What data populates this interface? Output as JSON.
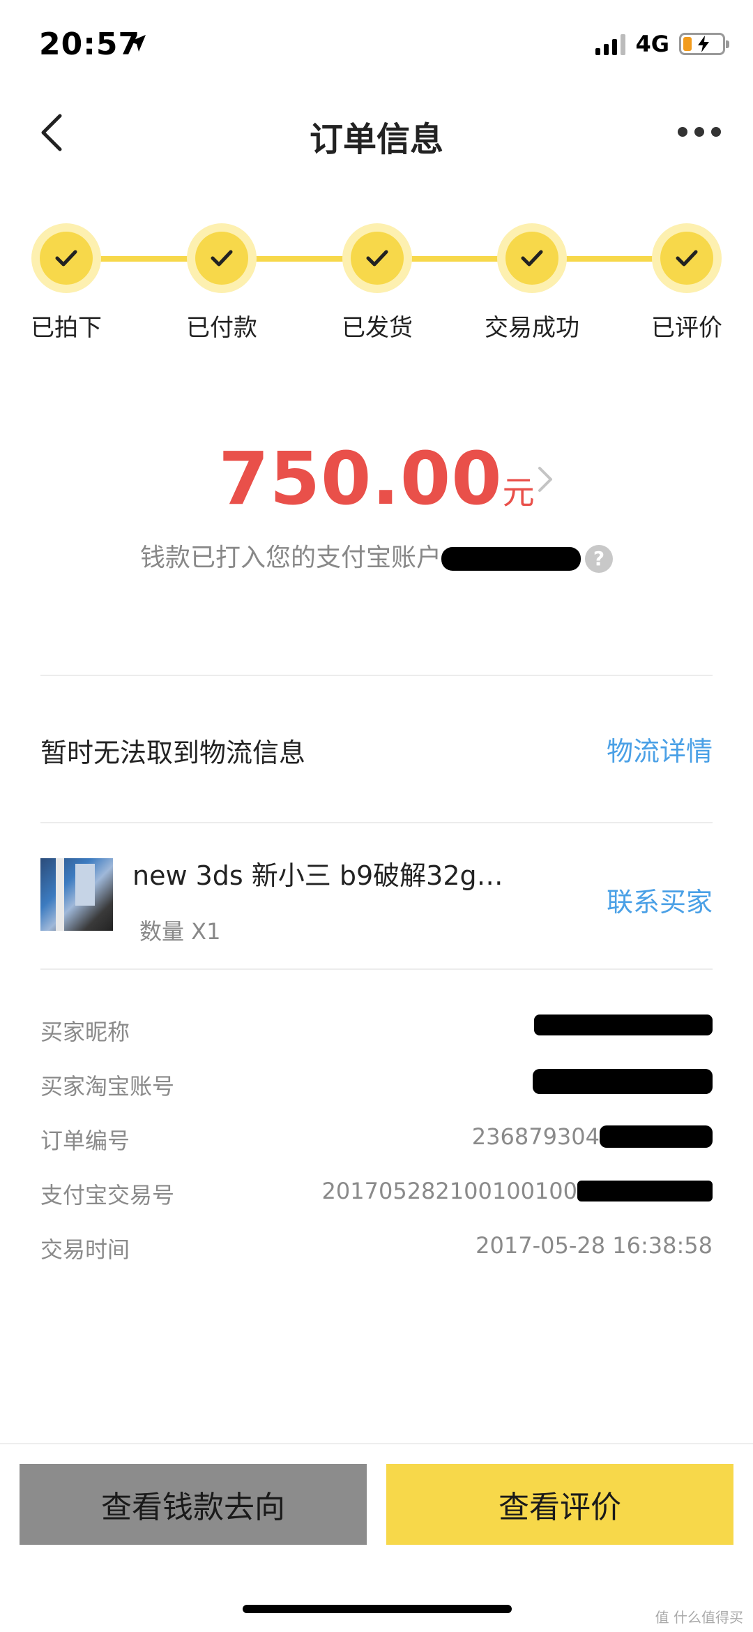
{
  "status_bar": {
    "time": "20:57",
    "network": "4G"
  },
  "nav": {
    "title": "订单信息"
  },
  "progress": {
    "steps": [
      {
        "label": "已拍下"
      },
      {
        "label": "已付款"
      },
      {
        "label": "已发货"
      },
      {
        "label": "交易成功"
      },
      {
        "label": "已评价"
      }
    ]
  },
  "amount": {
    "value": "750.00",
    "unit": "元",
    "payout_text": "钱款已打入您的支付宝账户"
  },
  "logistics": {
    "text": "暂时无法取到物流信息",
    "link": "物流详情"
  },
  "item": {
    "title": "new 3ds 新小三 b9破解32g…",
    "quantity": "数量 X1",
    "contact": "联系买家"
  },
  "info": {
    "buyer_nickname_label": "买家昵称",
    "buyer_taobao_label": "买家淘宝账号",
    "order_no_label": "订单编号",
    "order_no_value": "236879304",
    "alipay_no_label": "支付宝交易号",
    "alipay_no_value": "201705282100100100",
    "time_label": "交易时间",
    "time_value": "2017-05-28 16:38:58"
  },
  "footer": {
    "money_button": "查看钱款去向",
    "review_button": "查看评价"
  },
  "watermark": "值 什么值得买",
  "colors": {
    "accent_yellow": "#f7d84a",
    "amount_red": "#e9504a",
    "link_blue": "#4aa0e6"
  }
}
